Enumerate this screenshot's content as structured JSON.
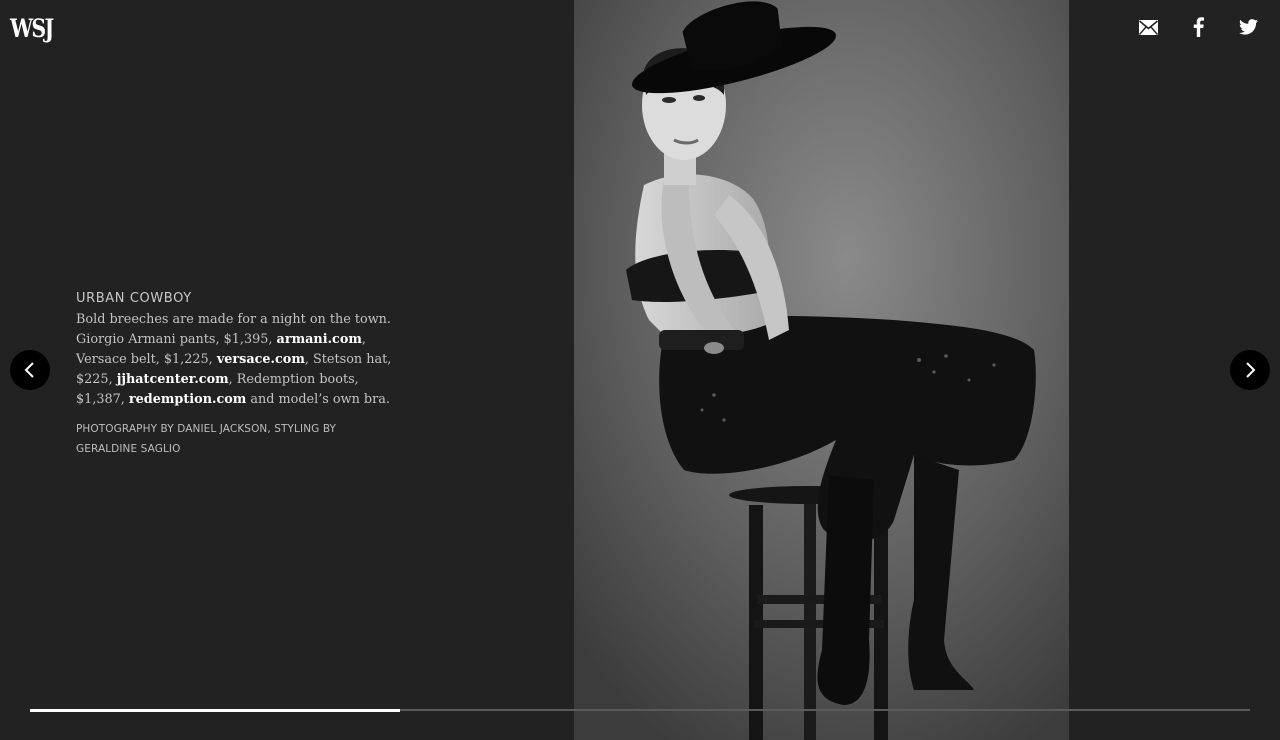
{
  "header": {
    "logo": "WSJ",
    "share": [
      {
        "icon": "email-icon"
      },
      {
        "icon": "facebook-icon"
      },
      {
        "icon": "twitter-icon"
      }
    ]
  },
  "caption": {
    "title": "URBAN COWBOY",
    "intro": "Bold breeches are made for a night on the town. Giorgio Armani pants, $1,395, ",
    "link1": "armani.com",
    "text2": ", Versace belt, $1,225, ",
    "link2": "versace.com",
    "text3": ", Stetson hat, $225, ",
    "link3": "jjhatcenter.com",
    "text4": ", Redemption boots, $1,387, ",
    "link4": "redemption.com",
    "text5": " and model’s own bra.",
    "credit": "PHOTOGRAPHY BY DANIEL JACKSON, STYLING BY GERALDINE SAGLIO"
  },
  "nav": {
    "prev_icon": "chevron-left-icon",
    "next_icon": "chevron-right-icon"
  },
  "slideshow": {
    "progress": 0.303
  },
  "colors": {
    "background": "#222222",
    "text": "#c4c4c4",
    "link": "#ffffff",
    "progress_track": "#5a5a5a",
    "progress_fill": "#ffffff"
  }
}
